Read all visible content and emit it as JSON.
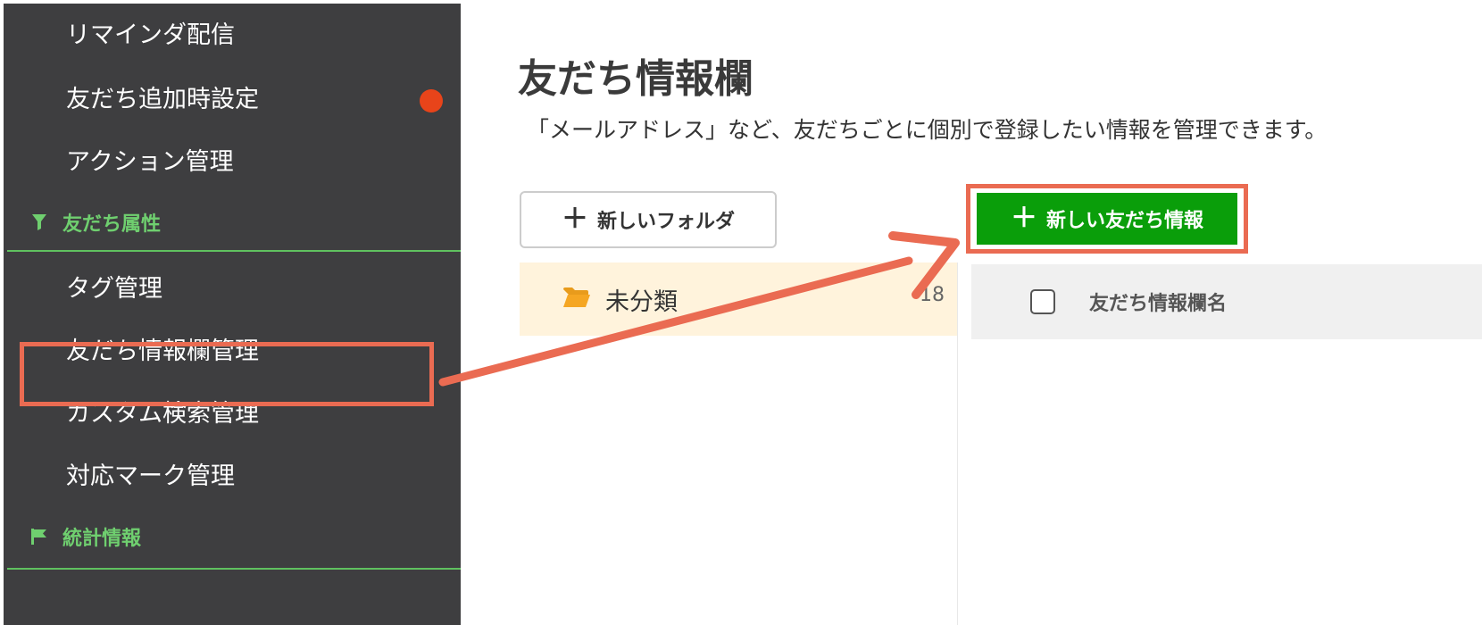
{
  "sidebar": {
    "items": [
      {
        "label": "リマインダ配信"
      },
      {
        "label": "友だち追加時設定",
        "badge": true
      },
      {
        "label": "アクション管理"
      },
      {
        "label": "タグ管理"
      },
      {
        "label": "友だち情報欄管理",
        "highlighted": true
      },
      {
        "label": "カスタム検索管理"
      },
      {
        "label": "対応マーク管理"
      }
    ],
    "sections": [
      {
        "label": "友だち属性",
        "icon": "filter-icon"
      },
      {
        "label": "統計情報",
        "icon": "flag-icon"
      }
    ]
  },
  "main": {
    "title": "友だち情報欄",
    "description": "「メールアドレス」など、友だちごとに個別で登録したい情報を管理できます。",
    "new_folder_label": "新しいフォルダ",
    "new_friend_info_label": "新しい友だち情報",
    "folders": [
      {
        "name": "未分類",
        "count": "18"
      }
    ],
    "table": {
      "column_name": "友だち情報欄名"
    }
  },
  "colors": {
    "sidebar_bg": "#3e3e40",
    "accent_green": "#0a9e0a",
    "section_green": "#6fcf6f",
    "highlight": "#ea6b52",
    "badge": "#e8441a",
    "folder_row": "#fff3dc"
  }
}
